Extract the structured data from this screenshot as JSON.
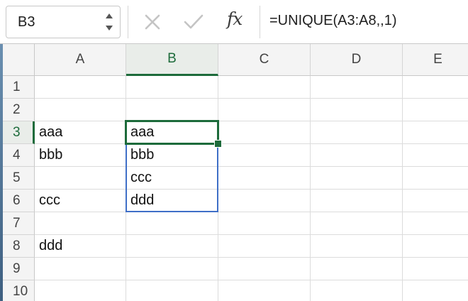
{
  "formula_bar": {
    "name_box": "B3",
    "fx_label": "fx",
    "formula": "=UNIQUE(A3:A8,,1)"
  },
  "columns": [
    "A",
    "B",
    "C",
    "D",
    "E"
  ],
  "active_column": "B",
  "active_row": "3",
  "rows": [
    {
      "num": "1",
      "A": "",
      "B": ""
    },
    {
      "num": "2",
      "A": "",
      "B": ""
    },
    {
      "num": "3",
      "A": "aaa",
      "B": "aaa"
    },
    {
      "num": "4",
      "A": "bbb",
      "B": "bbb"
    },
    {
      "num": "5",
      "A": "",
      "B": "ccc"
    },
    {
      "num": "6",
      "A": "ccc",
      "B": "ddd"
    },
    {
      "num": "7",
      "A": "",
      "B": ""
    },
    {
      "num": "8",
      "A": "ddd",
      "B": ""
    },
    {
      "num": "9",
      "A": "",
      "B": ""
    },
    {
      "num": "10",
      "A": "",
      "B": ""
    }
  ],
  "colors": {
    "active": "#1d6b3b",
    "spill_border": "#3f6fc7"
  }
}
